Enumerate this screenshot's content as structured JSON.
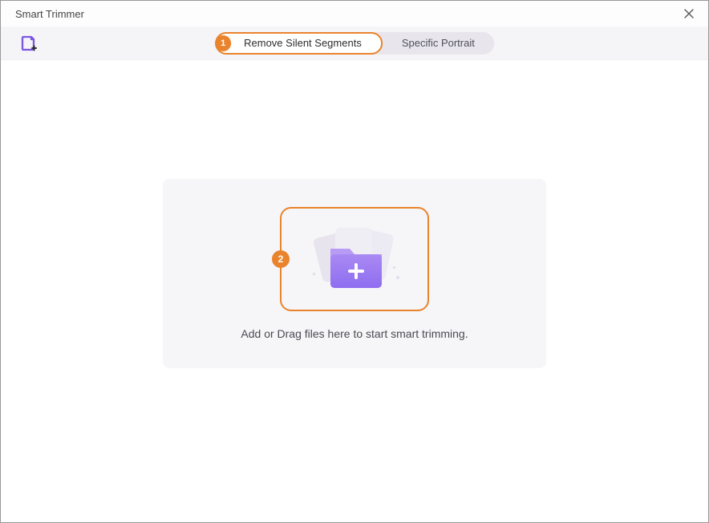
{
  "window": {
    "title": "Smart Trimmer"
  },
  "tabs": {
    "active": "Remove Silent Segments",
    "inactive": "Specific Portrait",
    "badge_active": "1"
  },
  "dropzone": {
    "badge": "2",
    "hint": "Add or Drag files here to start smart trimming."
  },
  "colors": {
    "accent": "#e9842c",
    "folder_light": "#b79bf5",
    "folder_dark": "#8f6df0"
  }
}
